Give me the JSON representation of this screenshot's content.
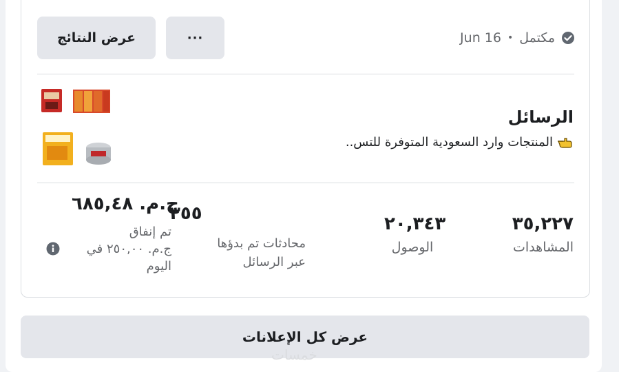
{
  "header": {
    "status_text": "مكتمل",
    "separator": "•",
    "date": "Jun 16",
    "more_label": "···",
    "view_results_label": "عرض النتائج"
  },
  "ad": {
    "title": "الرسائل",
    "description": "المنتجات وارد السعودية المتوفرة للتس..",
    "pointer_icon": "hand-pointing-icon"
  },
  "metrics": {
    "views": {
      "value": "٣٥,٢٢٧",
      "label": "المشاهدات"
    },
    "reach": {
      "value": "٢٠,٣٤٣",
      "label": "الوصول"
    },
    "conversations": {
      "value": "٣٥٥",
      "label_line1": "محادثات تم بدؤها",
      "label_line2": "عبر الرسائل"
    },
    "spend": {
      "value": "ج.م. ٦٨٥,٤٨",
      "label_line1": "تم إنفاق",
      "label_line2": "ج.م. ٢٥٠,٠٠ في",
      "label_line3": "اليوم",
      "info_icon": "info-icon"
    }
  },
  "footer": {
    "view_all_ads_label": "عرض كل الإعلانات",
    "watermark": "خمسات"
  },
  "colors": {
    "background": "#f0f2f5",
    "card": "#ffffff",
    "button": "#e4e6eb",
    "muted_text": "#65676b",
    "check": "#606770"
  }
}
